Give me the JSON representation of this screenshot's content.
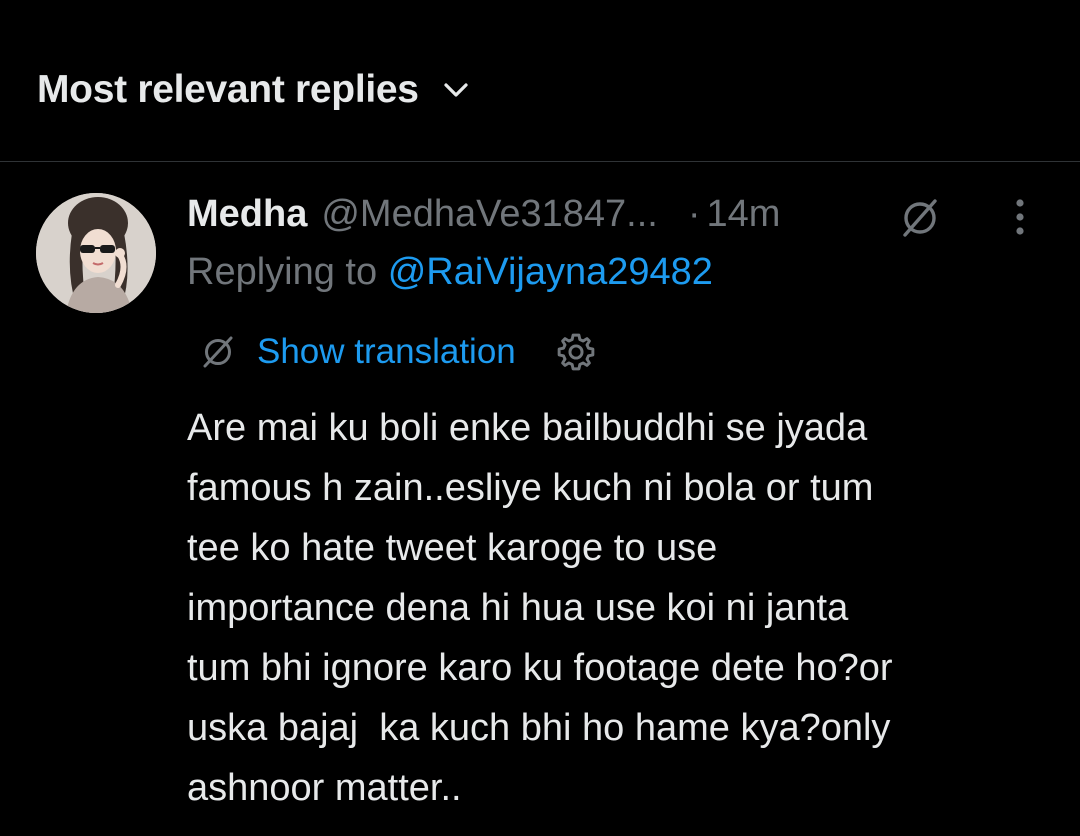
{
  "header": {
    "sort_label": "Most relevant replies",
    "sort_icon": "chevron-down-icon"
  },
  "reply": {
    "author_name": "Medha",
    "author_handle": "@MedhaVe31847...",
    "separator": "·",
    "time": "14m",
    "header_icon": "grok-slash-icon",
    "more_icon": "more-vertical-icon",
    "replying_prefix": "Replying to",
    "replying_to": "@RaiVijayna29482",
    "translation_icon": "grok-slash-icon",
    "translation_label": "Show translation",
    "translation_settings_icon": "gear-icon",
    "text_lines": [
      "Are mai ku boli enke bailbuddhi se jyada",
      "famous h zain..esliye kuch ni bola or tum",
      "tee ko hate tweet karoge to use",
      "importance dena hi hua use koi ni janta",
      "tum bhi ignore karo ku footage dete ho?or",
      "uska bajaj  ka kuch bhi ho hame kya?only",
      "ashnoor matter.."
    ]
  },
  "colors": {
    "background": "#000000",
    "primary_text": "#e7e9ea",
    "secondary_text": "#71767b",
    "link": "#1d9bf0",
    "divider": "#2f3336"
  }
}
